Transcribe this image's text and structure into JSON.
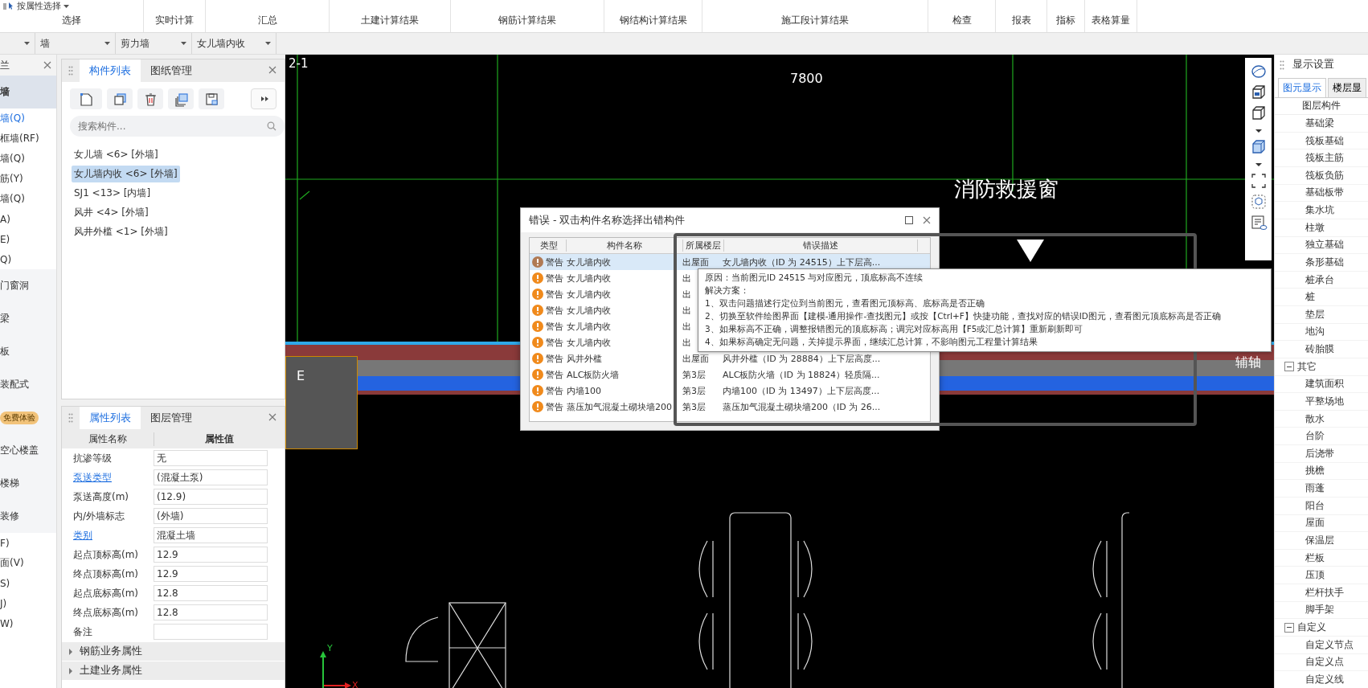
{
  "ribbon": {
    "select_by_property": "按属性选择",
    "groups": [
      "选择",
      "实时计算",
      "汇总",
      "土建计算结果",
      "钢筋计算结果",
      "钢结构计算结果",
      "施工段计算结果",
      "检查",
      "报表",
      "指标",
      "表格算量"
    ]
  },
  "filters": [
    {
      "kind": "blank"
    },
    {
      "kind": "select",
      "value": "墙"
    },
    {
      "kind": "select",
      "value": "剪力墙"
    },
    {
      "kind": "select",
      "value": "女儿墙内收"
    }
  ],
  "nav": {
    "title": "兰",
    "items": [
      {
        "kind": "group",
        "label": "墙",
        "selected": true
      },
      {
        "kind": "item",
        "label": "墙(Q)",
        "selected": true
      },
      {
        "kind": "item",
        "label": "框墙(RF)",
        "selected": false
      },
      {
        "kind": "item",
        "label": "墙(Q)",
        "selected": false
      },
      {
        "kind": "item",
        "label": "筋(Y)",
        "selected": false
      },
      {
        "kind": "item",
        "label": "墙(Q)",
        "selected": false
      },
      {
        "kind": "item",
        "label": "A)",
        "selected": false
      },
      {
        "kind": "item",
        "label": "E)",
        "selected": false
      },
      {
        "kind": "item",
        "label": "Q)",
        "selected": false
      },
      {
        "kind": "group",
        "label": "门窗洞",
        "selected": false
      },
      {
        "kind": "group",
        "label": "梁",
        "selected": false
      },
      {
        "kind": "group",
        "label": "板",
        "selected": false
      },
      {
        "kind": "group",
        "label": "装配式",
        "selected": false
      },
      {
        "kind": "group",
        "badge": "免费体验",
        "selected": false
      },
      {
        "kind": "group",
        "label": "空心楼盖",
        "selected": false
      },
      {
        "kind": "group",
        "label": "楼梯",
        "selected": false
      },
      {
        "kind": "group",
        "label": "装修",
        "selected": false
      },
      {
        "kind": "item",
        "label": "F)",
        "selected": false
      },
      {
        "kind": "item",
        "label": "面(V)",
        "selected": false
      },
      {
        "kind": "item",
        "label": "S)",
        "selected": false
      },
      {
        "kind": "item",
        "label": "J)",
        "selected": false
      },
      {
        "kind": "item",
        "label": "W)",
        "selected": false
      }
    ]
  },
  "component_panel": {
    "tabs": [
      {
        "label": "构件列表",
        "selected": true
      },
      {
        "label": "图纸管理",
        "selected": false
      }
    ],
    "search": {
      "placeholder": "搜索构件..."
    },
    "items": [
      {
        "label": "女儿墙 <6> [外墙]",
        "selected": false
      },
      {
        "label": "女儿墙内收 <6> [外墙]",
        "selected": true
      },
      {
        "label": "SJ1 <13> [内墙]",
        "selected": false
      },
      {
        "label": "风井 <4> [外墙]",
        "selected": false
      },
      {
        "label": "风井外槛 <1> [外墙]",
        "selected": false
      }
    ]
  },
  "property_panel": {
    "tabs": [
      {
        "label": "属性列表",
        "selected": true
      },
      {
        "label": "图层管理",
        "selected": false
      }
    ],
    "columns": [
      "属性名称",
      "属性值"
    ],
    "rows": [
      {
        "name": "抗渗等级",
        "value": "无",
        "link": false
      },
      {
        "name": "泵送类型",
        "value": "(混凝土泵)",
        "link": true
      },
      {
        "name": "泵送高度(m)",
        "value": "(12.9)",
        "link": false
      },
      {
        "name": "内/外墙标志",
        "value": "(外墙)",
        "link": false
      },
      {
        "name": "类别",
        "value": "混凝土墙",
        "link": true
      },
      {
        "name": "起点顶标高(m)",
        "value": "12.9",
        "link": false
      },
      {
        "name": "终点顶标高(m)",
        "value": "12.9",
        "link": false
      },
      {
        "name": "起点底标高(m)",
        "value": "12.8",
        "link": false
      },
      {
        "name": "终点底标高(m)",
        "value": "12.8",
        "link": false
      },
      {
        "name": "备注",
        "link": false
      }
    ],
    "groups": [
      {
        "label": "钢筋业务属性",
        "expanded": false
      },
      {
        "label": "土建业务属性",
        "expanded": false
      }
    ]
  },
  "canvas": {
    "grid_label": "2-1",
    "dimension": "7800",
    "window_label": "消防救援窗",
    "section_label": "E",
    "axis_label": "辅轴",
    "axis_y": "Y",
    "axis_x": "X"
  },
  "error_dialog": {
    "title": "错误 - 双击构件名称选择出错构件",
    "columns": [
      "类型",
      "构件名称",
      "所属楼层",
      "错误描述"
    ],
    "rows": [
      {
        "type": "警告",
        "name": "女儿墙内收",
        "floor": "出屋面",
        "description": "女儿墙内收（ID 为 24515）上下层高...",
        "selected": true
      },
      {
        "type": "警告",
        "name": "女儿墙内收",
        "floor": "出",
        "selected": false
      },
      {
        "type": "警告",
        "name": "女儿墙内收",
        "floor": "出",
        "selected": false
      },
      {
        "type": "警告",
        "name": "女儿墙内收",
        "floor": "出",
        "selected": false
      },
      {
        "type": "警告",
        "name": "女儿墙内收",
        "floor": "出",
        "selected": false
      },
      {
        "type": "警告",
        "name": "女儿墙内收",
        "floor": "出",
        "selected": false
      },
      {
        "type": "警告",
        "name": "风井外槛",
        "floor": "出屋面",
        "description": "风井外槛（ID 为 28884）上下层高度...",
        "selected": false
      },
      {
        "type": "警告",
        "name": "ALC板防火墙",
        "floor": "第3层",
        "description": "ALC板防火墙（ID 为 18824）轻质隔...",
        "selected": false
      },
      {
        "type": "警告",
        "name": "内墙100",
        "floor": "第3层",
        "description": "内墙100（ID 为 13497）上下层高度...",
        "selected": false
      },
      {
        "type": "警告",
        "name": "蒸压加气混凝土砌块墙200",
        "floor": "第3层",
        "description": "蒸压加气混凝土砌块墙200（ID 为 26...",
        "selected": false
      }
    ],
    "tooltip": [
      "原因：当前图元ID 24515 与对应图元，顶底标高不连续",
      "解决方案：",
      "1、双击问题描述行定位到当前图元，查看图元顶标高、底标高是否正确",
      "2、切换至软件绘图界面【建模-通用操作-查找图元】或按【Ctrl+F】快捷功能，查找对应的错误ID图元，查看图元顶底标高是否正确",
      "3、如果标高不正确，调整报错图元的顶底标高；调完对应标高用【F5或汇总计算】重新刷新即可",
      "4、如果标高确定无问题，关掉提示界面，继续汇总计算，不影响图元工程量计算结果"
    ]
  },
  "display_panel": {
    "title": "显示设置",
    "tabs": [
      {
        "label": "图元显示",
        "selected": true
      },
      {
        "label": "楼层显",
        "selected": false
      }
    ],
    "header": "图层构件",
    "tree": [
      {
        "children": [
          {
            "label": "基础梁"
          },
          {
            "label": "筏板基础"
          },
          {
            "label": "筏板主筋"
          },
          {
            "label": "筏板负筋"
          },
          {
            "label": "基础板带"
          },
          {
            "label": "集水坑"
          },
          {
            "label": "柱墩"
          },
          {
            "label": "独立基础"
          },
          {
            "label": "条形基础"
          },
          {
            "label": "桩承台"
          },
          {
            "label": "桩"
          },
          {
            "label": "垫层"
          },
          {
            "label": "地沟"
          },
          {
            "label": "砖胎膜"
          }
        ]
      },
      {
        "label": "其它",
        "expanded": true,
        "children": [
          {
            "label": "建筑面积"
          },
          {
            "label": "平整场地"
          },
          {
            "label": "散水"
          },
          {
            "label": "台阶"
          },
          {
            "label": "后浇带"
          },
          {
            "label": "挑檐"
          },
          {
            "label": "雨蓬"
          },
          {
            "label": "阳台"
          },
          {
            "label": "屋面"
          },
          {
            "label": "保温层"
          },
          {
            "label": "栏板"
          },
          {
            "label": "压顶"
          },
          {
            "label": "栏杆扶手"
          },
          {
            "label": "脚手架"
          }
        ]
      },
      {
        "label": "自定义",
        "expanded": true,
        "children": [
          {
            "label": "自定义节点"
          },
          {
            "label": "自定义点"
          },
          {
            "label": "自定义线"
          }
        ]
      }
    ]
  }
}
